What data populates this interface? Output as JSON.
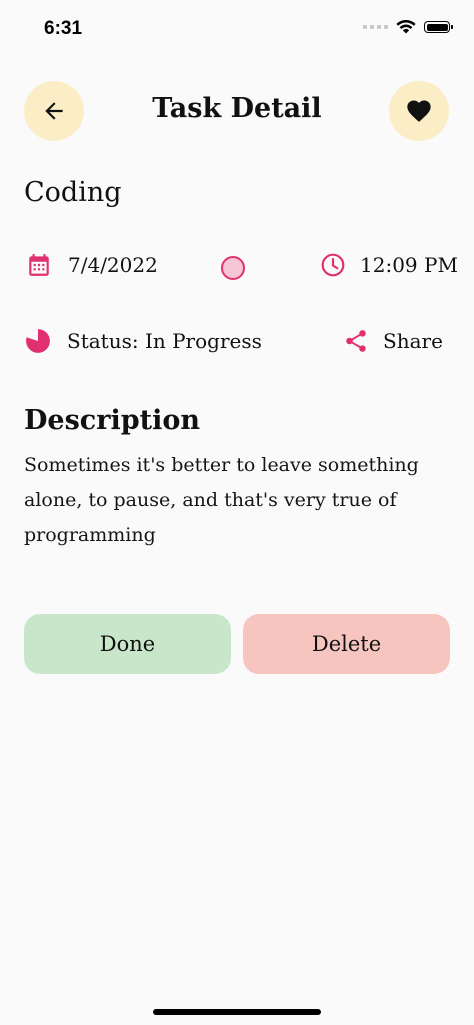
{
  "status_bar": {
    "time": "6:31"
  },
  "header": {
    "title": "Task Detail"
  },
  "task": {
    "name": "Coding",
    "date": "7/4/2022",
    "time": "12:09 PM",
    "color": "#f6c6d7",
    "status_text": "Status: In Progress",
    "share_label": "Share"
  },
  "description": {
    "heading": "Description",
    "text": "Sometimes it's better to leave something alone, to pause, and that's very true of programming"
  },
  "actions": {
    "done_label": "Done",
    "delete_label": "Delete"
  },
  "colors": {
    "accent": "#e0306f",
    "circle_button": "#fbeec6",
    "done": "#c8e6c9",
    "delete": "#f7c5c0"
  },
  "icons": {
    "back": "arrow-left-icon",
    "favorite": "heart-icon",
    "date": "calendar-icon",
    "time": "clock-icon",
    "status": "pie-progress-icon",
    "share": "share-icon"
  }
}
